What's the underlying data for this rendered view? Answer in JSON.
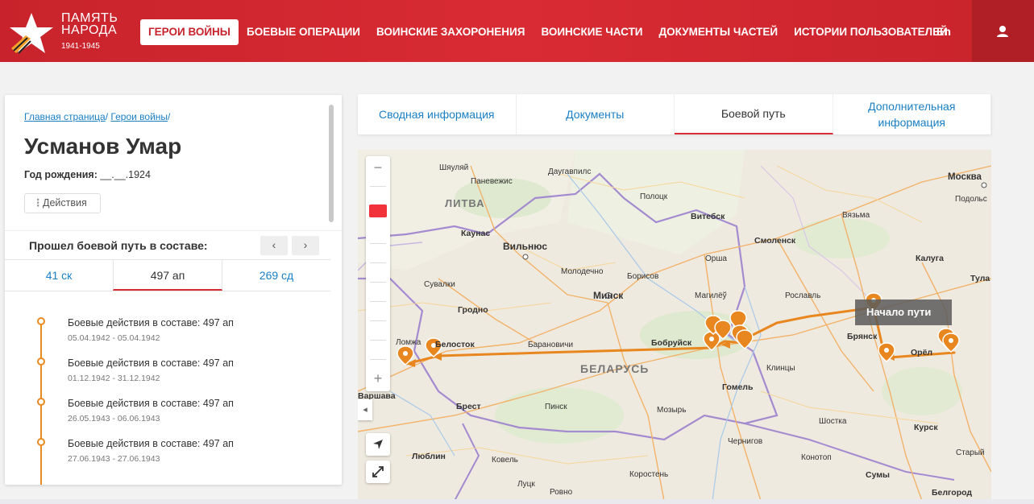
{
  "header": {
    "logo_line1": "ПАМЯТЬ",
    "logo_line2": "НАРОДА",
    "logo_years": "1941-1945",
    "nav": [
      {
        "label": "ГЕРОИ ВОЙНЫ"
      },
      {
        "label": "БОЕВЫЕ ОПЕРАЦИИ"
      },
      {
        "label": "ВОИНСКИЕ ЗАХОРОНЕНИЯ"
      },
      {
        "label": "ВОИНСКИЕ ЧАСТИ"
      },
      {
        "label": "ДОКУМЕНТЫ ЧАСТЕЙ"
      },
      {
        "label": "ИСТОРИИ ПОЛЬЗОВАТЕЛЕЙ"
      }
    ],
    "lang": "En",
    "user_icon": "user-icon",
    "brand_color": "#d92b33"
  },
  "left": {
    "crumbs": [
      "Главная страница",
      "Герои войны"
    ],
    "crumb_sep": "/",
    "name": "Усманов Умар",
    "birth_label": "Год рождения:",
    "birth_value": "__.__.1924",
    "actions_label": "Действия",
    "composition_label": "Прошел боевой путь в составе:",
    "prev_icon": "chevron-left-icon",
    "next_icon": "chevron-right-icon",
    "unit_tabs": [
      {
        "label": "41 ск"
      },
      {
        "label": "497 ап"
      },
      {
        "label": "269 сд"
      }
    ],
    "timeline": [
      {
        "title": "Боевые действия в составе: 497 ап",
        "date": "05.04.1942 - 05.04.1942"
      },
      {
        "title": "Боевые действия в составе: 497 ап",
        "date": "01.12.1942 - 31.12.1942"
      },
      {
        "title": "Боевые действия в составе: 497 ап",
        "date": "26.05.1943 - 06.06.1943"
      },
      {
        "title": "Боевые действия в составе: 497 ап",
        "date": "27.06.1943 - 27.06.1943"
      }
    ],
    "timeline_color": "#e98a22"
  },
  "tabs": [
    {
      "label": "Сводная информация"
    },
    {
      "label": "Документы"
    },
    {
      "label": "Боевой путь"
    },
    {
      "label": "Дополнительная информация"
    }
  ],
  "map": {
    "start_label": "Начало пути",
    "route_color": "#e8861f",
    "labels": {
      "litva": "ЛИТВА",
      "belarus": "БЕЛАРУСЬ",
      "shaulyai": "Шяуляй",
      "panevezhis": "Паневежис",
      "daugavpils": "Даугавпилс",
      "polotsk": "Полоцк",
      "vitebsk": "Витебск",
      "moskva": "Москва",
      "podolsk": "Подольс",
      "vyazma": "Вязьма",
      "kaunas": "Каунас",
      "vilnius": "Вильнюс",
      "smolensk": "Смоленск",
      "kaluga": "Калуга",
      "orsha": "Орша",
      "molodechno": "Молодечно",
      "borisov": "Борисов",
      "suvalki": "Сувалки",
      "tula": "Тула",
      "minsk": "Минск",
      "mogilev": "Магилёў",
      "roslavl": "Рославль",
      "grodno": "Гродно",
      "bryansk": "Брянск",
      "lomzha": "Ломжа",
      "belostok": "Белосток",
      "baranovichi": "Барановичи",
      "bobruisk": "Бобруйск",
      "orel": "Орёл",
      "klintsy": "Клинцы",
      "gomel": "Гомель",
      "varshava": "Варшава",
      "brest": "Брест",
      "pinsk": "Пинск",
      "mozyr": "Мозырь",
      "shostka": "Шостка",
      "kursk": "Курск",
      "chernigov": "Чернигов",
      "lublin": "Люблин",
      "kovel": "Ковель",
      "konotop": "Конотоп",
      "stary": "Старый",
      "lutsk": "Луцк",
      "rovno": "Ровно",
      "korosten": "Коростень",
      "sumy": "Сумы",
      "belgorod": "Белгород"
    },
    "controls": {
      "zoom_out": "−",
      "zoom_in": "+",
      "collapse": "◂",
      "locate_icon": "locate-arrow-icon",
      "fullscreen_icon": "fullscreen-icon"
    }
  }
}
